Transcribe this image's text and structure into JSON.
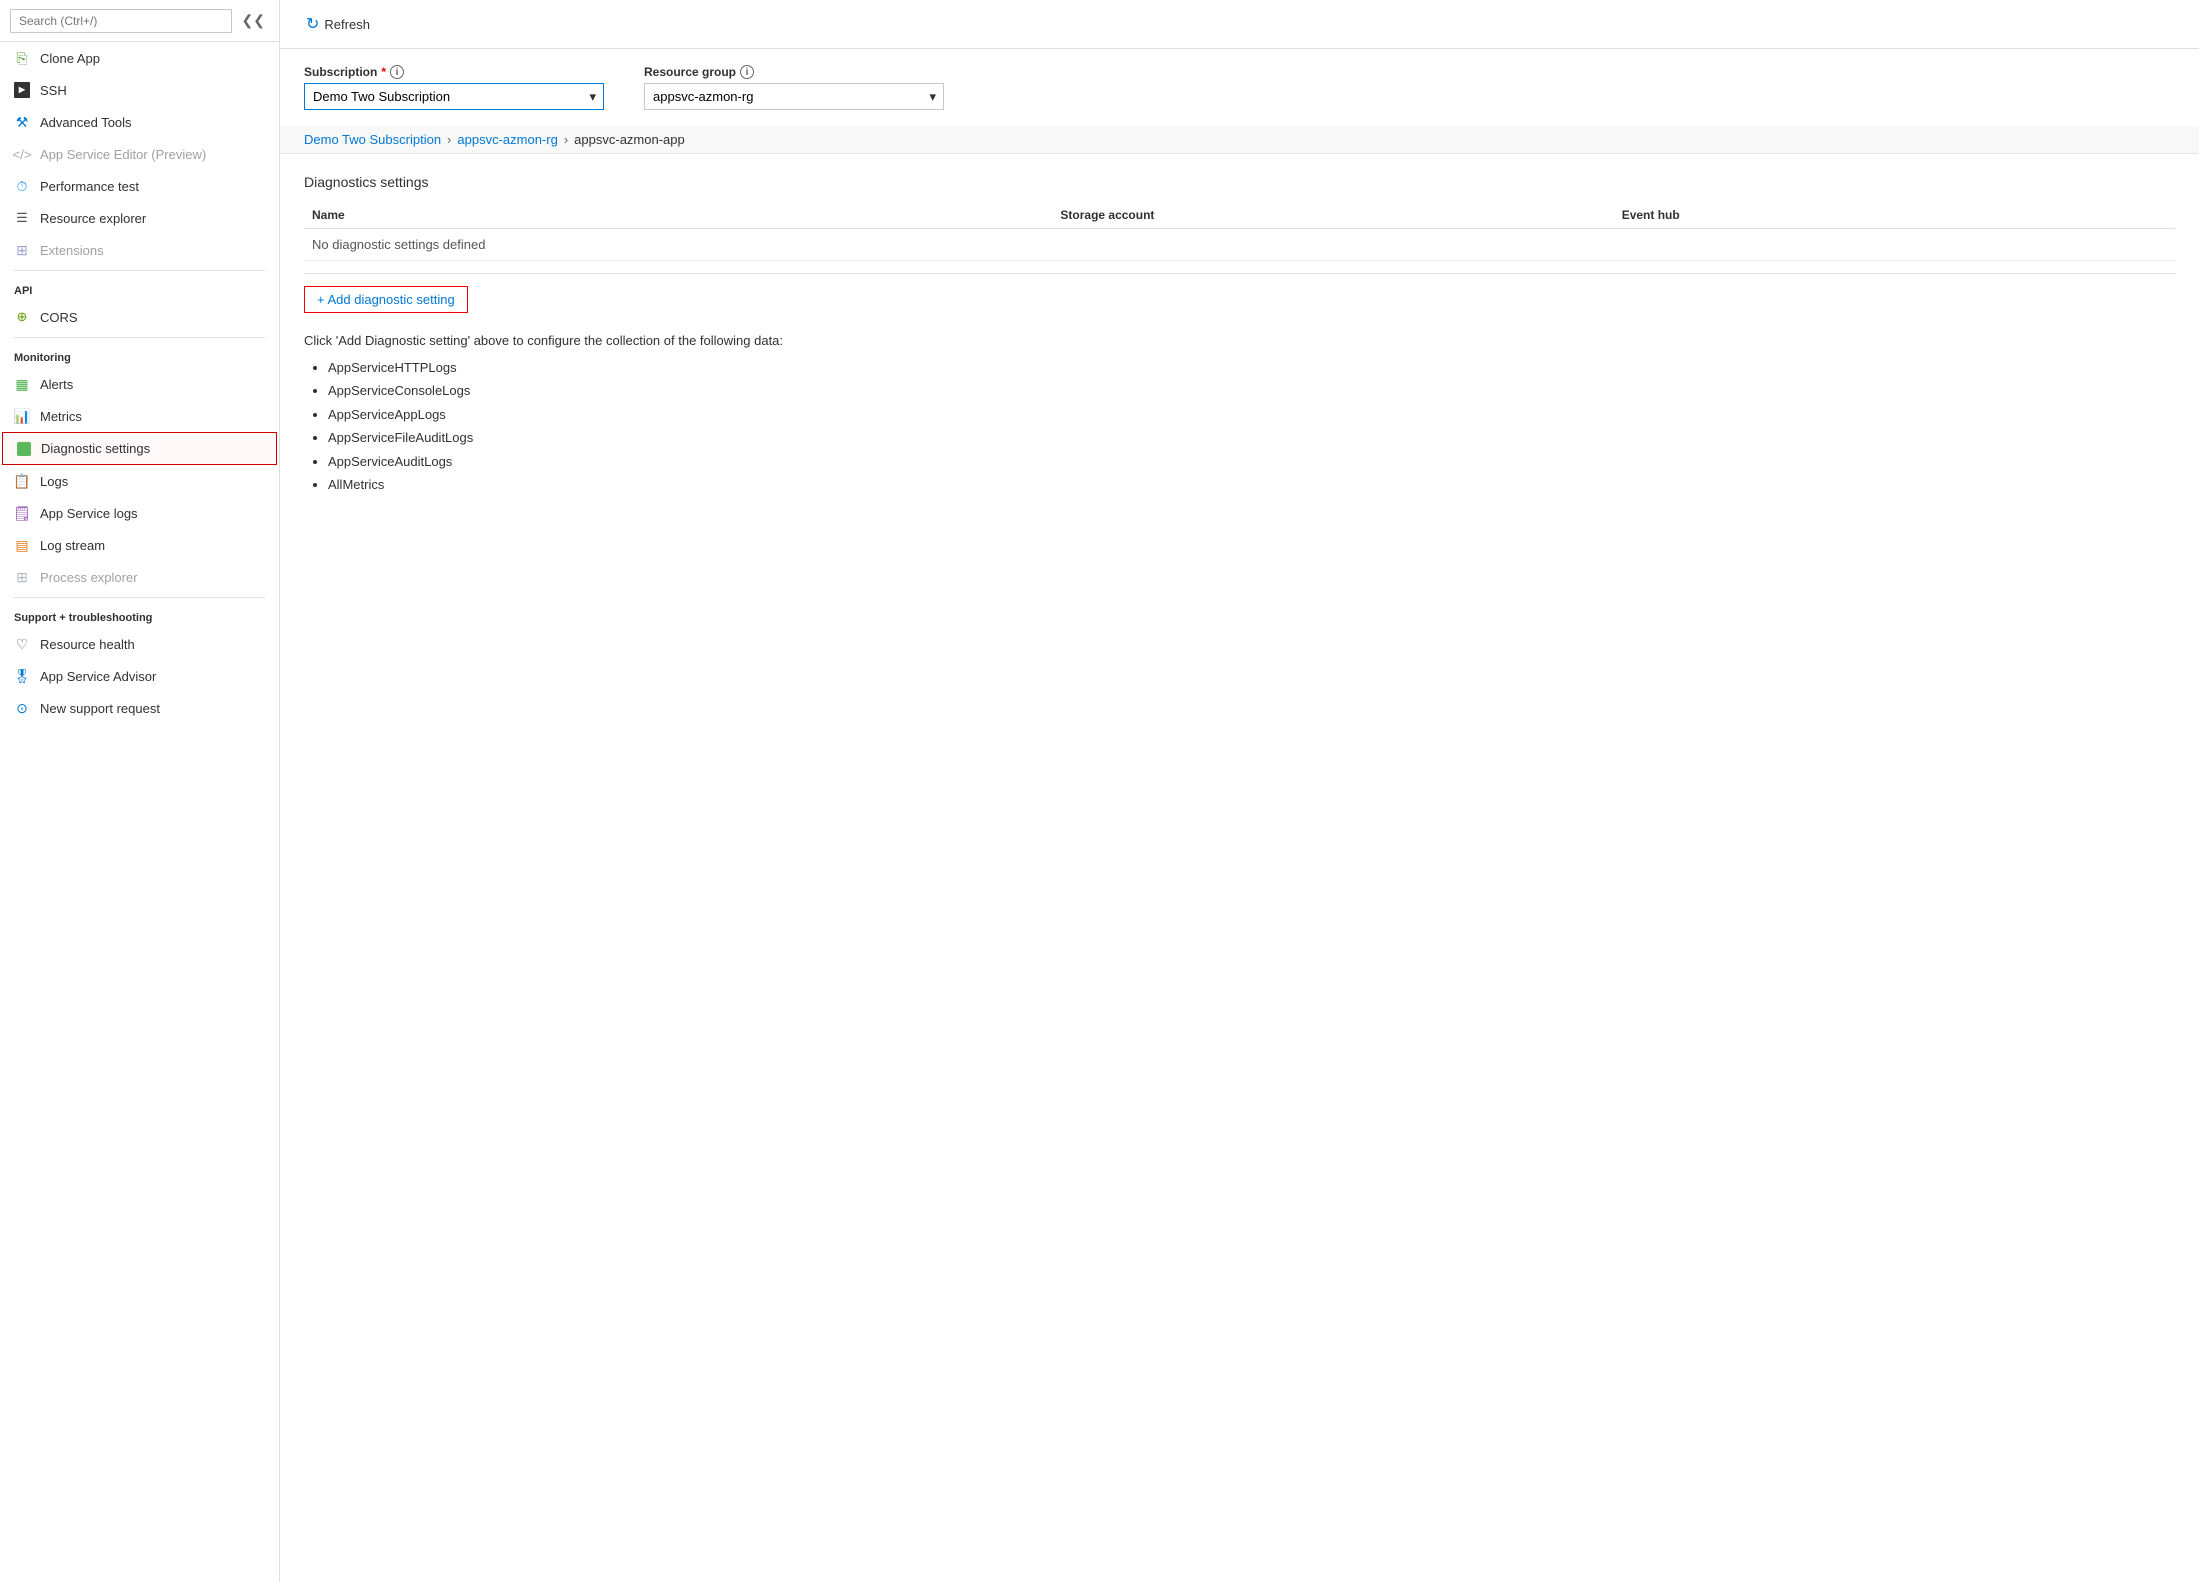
{
  "sidebar": {
    "search_placeholder": "Search (Ctrl+/)",
    "items": [
      {
        "id": "clone-app",
        "label": "Clone App",
        "icon": "clone",
        "disabled": false,
        "active": false
      },
      {
        "id": "ssh",
        "label": "SSH",
        "icon": "ssh",
        "disabled": false,
        "active": false
      },
      {
        "id": "advanced-tools",
        "label": "Advanced Tools",
        "icon": "tools",
        "disabled": false,
        "active": false
      },
      {
        "id": "app-service-editor",
        "label": "App Service Editor (Preview)",
        "icon": "editor",
        "disabled": true,
        "active": false
      },
      {
        "id": "performance-test",
        "label": "Performance test",
        "icon": "perf",
        "disabled": false,
        "active": false
      },
      {
        "id": "resource-explorer",
        "label": "Resource explorer",
        "icon": "resexplorer",
        "disabled": false,
        "active": false
      },
      {
        "id": "extensions",
        "label": "Extensions",
        "icon": "ext",
        "disabled": true,
        "active": false
      }
    ],
    "sections": [
      {
        "label": "API",
        "items": [
          {
            "id": "cors",
            "label": "CORS",
            "icon": "cors",
            "disabled": false,
            "active": false
          }
        ]
      },
      {
        "label": "Monitoring",
        "items": [
          {
            "id": "alerts",
            "label": "Alerts",
            "icon": "alerts",
            "disabled": false,
            "active": false
          },
          {
            "id": "metrics",
            "label": "Metrics",
            "icon": "metrics",
            "disabled": false,
            "active": false
          },
          {
            "id": "diagnostic-settings",
            "label": "Diagnostic settings",
            "icon": "diag",
            "disabled": false,
            "active": true
          },
          {
            "id": "logs",
            "label": "Logs",
            "icon": "logs",
            "disabled": false,
            "active": false
          },
          {
            "id": "app-service-logs",
            "label": "App Service logs",
            "icon": "applog",
            "disabled": false,
            "active": false
          },
          {
            "id": "log-stream",
            "label": "Log stream",
            "icon": "logstream",
            "disabled": false,
            "active": false
          },
          {
            "id": "process-explorer",
            "label": "Process explorer",
            "icon": "procexp",
            "disabled": true,
            "active": false
          }
        ]
      },
      {
        "label": "Support + troubleshooting",
        "items": [
          {
            "id": "resource-health",
            "label": "Resource health",
            "icon": "reshealth",
            "disabled": false,
            "active": false
          },
          {
            "id": "app-service-advisor",
            "label": "App Service Advisor",
            "icon": "advisor",
            "disabled": false,
            "active": false
          },
          {
            "id": "new-support-request",
            "label": "New support request",
            "icon": "support",
            "disabled": false,
            "active": false
          }
        ]
      }
    ]
  },
  "toolbar": {
    "refresh_label": "Refresh"
  },
  "breadcrumb": {
    "subscription": "Demo Two Subscription",
    "resource_group": "appsvc-azmon-rg",
    "app": "appsvc-azmon-app"
  },
  "form": {
    "subscription_label": "Subscription",
    "subscription_required": "*",
    "subscription_value": "Demo Two Subscription",
    "resource_group_label": "Resource group",
    "resource_group_value": "appsvc-azmon-rg"
  },
  "diagnostics": {
    "section_title": "Diagnostics settings",
    "col_name": "Name",
    "col_storage": "Storage account",
    "col_eventhub": "Event hub",
    "empty_message": "No diagnostic settings defined",
    "add_button_label": "+ Add diagnostic setting",
    "instruction": "Click 'Add Diagnostic setting' above to configure the collection of the following data:",
    "data_types": [
      "AppServiceHTTPLogs",
      "AppServiceConsoleLogs",
      "AppServiceAppLogs",
      "AppServiceFileAuditLogs",
      "AppServiceAuditLogs",
      "AllMetrics"
    ]
  }
}
